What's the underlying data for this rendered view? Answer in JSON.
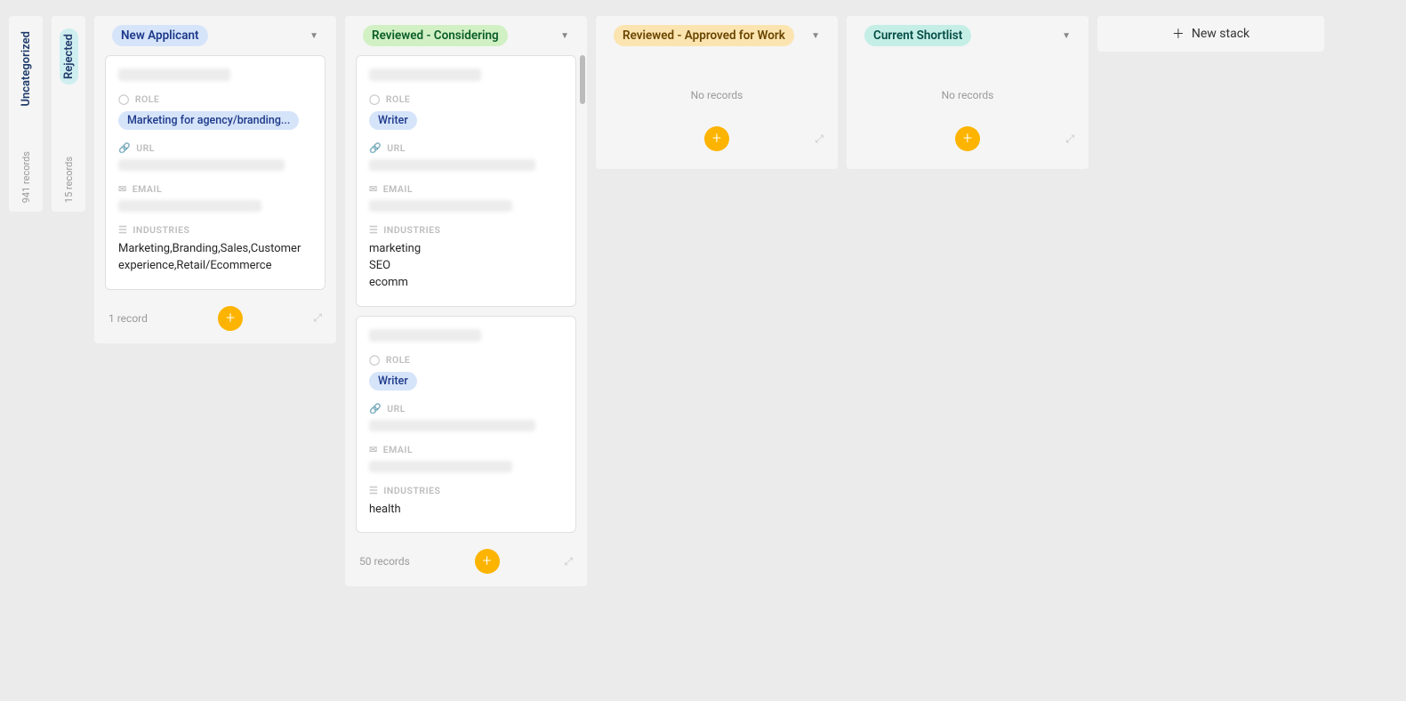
{
  "collapsed_stacks": [
    {
      "label": "Uncategorized",
      "count": "941 records",
      "pill_class": "pill-uncat"
    },
    {
      "label": "Rejected",
      "count": "15 records",
      "pill_class": "pill-rejected"
    }
  ],
  "stacks": [
    {
      "label": "New Applicant",
      "pill_class": "p-blue",
      "footer_count": "1 record",
      "cards": [
        {
          "role": "Marketing for agency/branding...",
          "industries": "Marketing,Branding,Sales,Customer experience,Retail/Ecommerce"
        }
      ]
    },
    {
      "label": "Reviewed - Considering",
      "pill_class": "p-green",
      "footer_count": "50 records",
      "show_scroll": true,
      "cards": [
        {
          "role": "Writer",
          "industries": "marketing\nSEO\necomm"
        },
        {
          "role": "Writer",
          "industries": "health"
        }
      ]
    },
    {
      "label": "Reviewed - Approved for Work",
      "pill_class": "p-orange",
      "empty_text": "No records"
    },
    {
      "label": "Current Shortlist",
      "pill_class": "p-teal",
      "empty_text": "No records"
    }
  ],
  "fields": {
    "role": "ROLE",
    "url": "URL",
    "email": "EMAIL",
    "industries": "INDUSTRIES"
  },
  "new_stack_label": "New stack"
}
